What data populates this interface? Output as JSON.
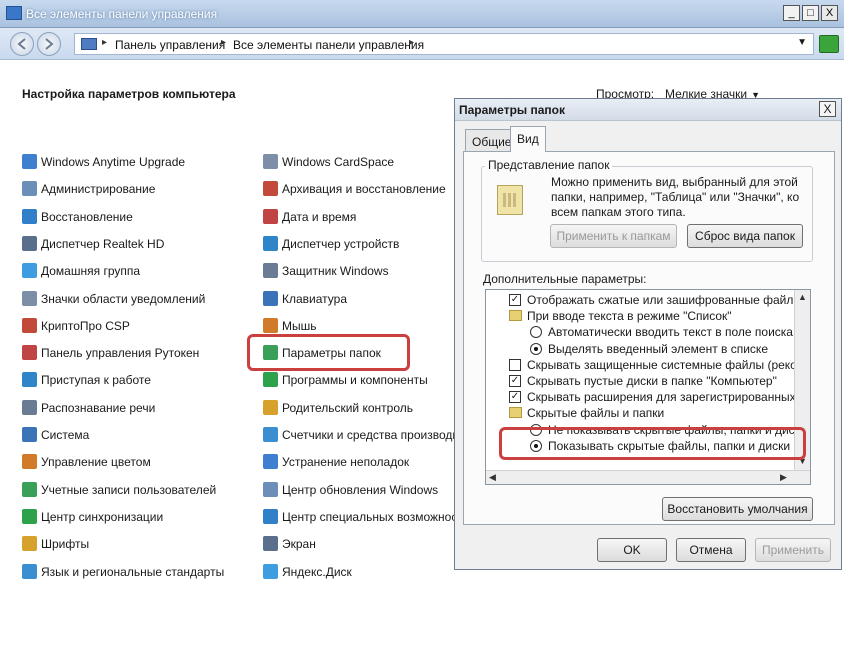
{
  "window": {
    "title": "Все элементы панели управления",
    "buttons": {
      "minimize": "_",
      "maximize": "□",
      "close": "X"
    }
  },
  "address": {
    "crumbs": [
      "Панель управления",
      "Все элементы панели управления"
    ]
  },
  "page": {
    "title": "Настройка параметров компьютера",
    "view_label": "Просмотр:",
    "view_value": "Мелкие значки"
  },
  "left_items": [
    "Windows Anytime Upgrade",
    "Администрирование",
    "Восстановление",
    "Диспетчер Realtek HD",
    "Домашняя группа",
    "Значки области уведомлений",
    "КриптоПро CSP",
    "Панель управления Рутокен",
    "Приступая к работе",
    "Распознавание речи",
    "Система",
    "Управление цветом",
    "Учетные записи пользователей",
    "Центр синхронизации",
    "Шрифты",
    "Язык и региональные стандарты"
  ],
  "right_items": [
    "Windows CardSpace",
    "Архивация и восстановление",
    "Дата и время",
    "Диспетчер устройств",
    "Защитник Windows",
    "Клавиатура",
    "Мышь",
    "Параметры папок",
    "Программы и компоненты",
    "Родительский контроль",
    "Счетчики и средства производите",
    "Устранение неполадок",
    "Центр обновления Windows",
    "Центр специальных возможносте",
    "Экран",
    "Яндекс.Диск"
  ],
  "dialog": {
    "title": "Параметры папок",
    "close": "X",
    "tabs": [
      "Общие",
      "Вид"
    ],
    "group_label": "Представление папок",
    "group_desc": "Можно применить вид, выбранный для этой папки, например, \"Таблица\" или \"Значки\", ко всем папкам этого типа.",
    "apply_to_folders": "Применить к папкам",
    "reset_folders": "Сброс вида папок",
    "advanced_label": "Дополнительные параметры:",
    "tree": [
      {
        "kind": "checkbox",
        "checked": true,
        "indent": 1,
        "text": "Отображать сжатые или зашифрованные файлы NT"
      },
      {
        "kind": "folder",
        "indent": 1,
        "text": "При вводе текста в режиме \"Список\""
      },
      {
        "kind": "radio",
        "checked": false,
        "indent": 2,
        "text": "Автоматически вводить текст в поле поиска"
      },
      {
        "kind": "radio",
        "checked": true,
        "indent": 2,
        "text": "Выделять введенный элемент в списке"
      },
      {
        "kind": "checkbox",
        "checked": false,
        "indent": 1,
        "text": "Скрывать защищенные системные файлы (рекомен"
      },
      {
        "kind": "checkbox",
        "checked": true,
        "indent": 1,
        "text": "Скрывать пустые диски в папке \"Компьютер\""
      },
      {
        "kind": "checkbox",
        "checked": true,
        "indent": 1,
        "text": "Скрывать расширения для зарегистрированных типо"
      },
      {
        "kind": "folder",
        "indent": 1,
        "text": "Скрытые файлы и папки"
      },
      {
        "kind": "radio",
        "checked": false,
        "indent": 2,
        "text": "Не показывать скрытые файлы, папки и диски"
      },
      {
        "kind": "radio",
        "checked": true,
        "indent": 2,
        "text": "Показывать скрытые файлы, папки и диски"
      }
    ],
    "restore_defaults": "Восстановить умолчания",
    "ok": "OK",
    "cancel": "Отмена",
    "apply": "Применить"
  },
  "icon_colors": [
    "#3f7fd0",
    "#6b8fb8",
    "#2f7fc9",
    "#5a6f8c",
    "#3d9de0",
    "#7c8fa6",
    "#c24a3a",
    "#c04444",
    "#2e86c8",
    "#6a7c93",
    "#3b73b8",
    "#d07a2a",
    "#3aa058",
    "#2ca34a",
    "#d6a22c",
    "#3b8fd0"
  ]
}
